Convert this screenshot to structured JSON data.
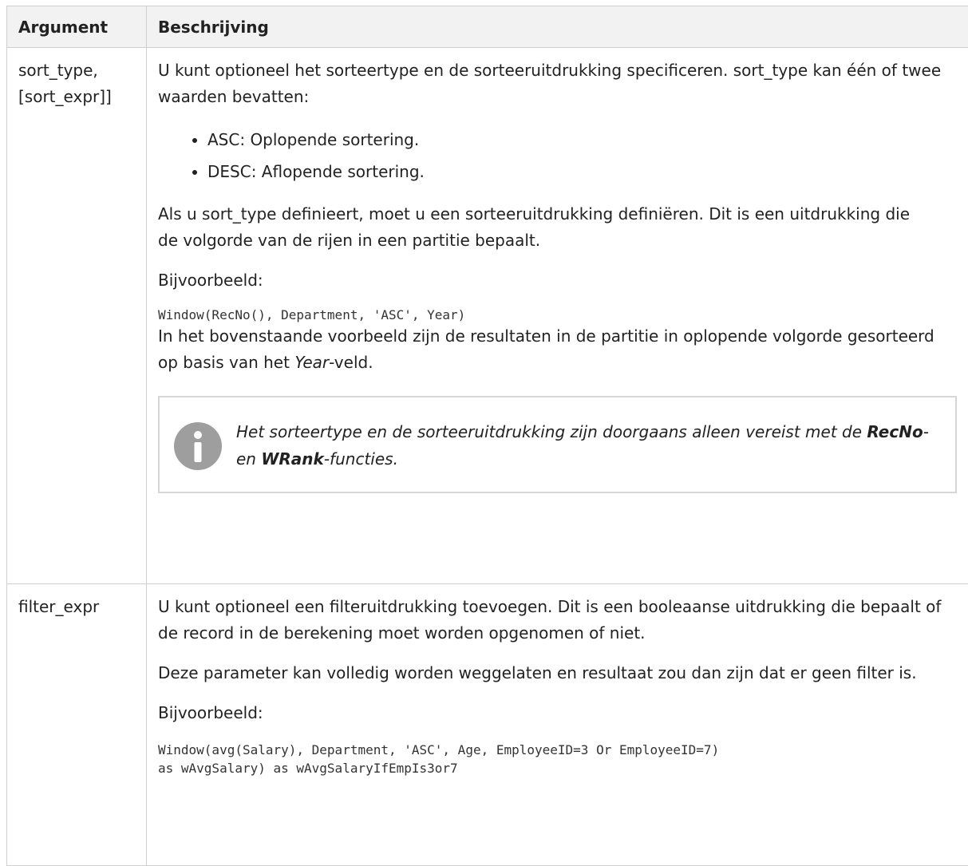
{
  "header": {
    "col1": "Argument",
    "col2": "Beschrijving"
  },
  "rows": [
    {
      "arg_line1": "sort_type,",
      "arg_line2": "[sort_expr]]",
      "p1": "U kunt optioneel het sorteertype en de sorteeruitdrukking specificeren. sort_type kan één of twee waarden bevatten:",
      "items": [
        "ASC: Oplopende sortering.",
        "DESC: Aflopende sortering."
      ],
      "p2": "Als u sort_type definieert, moet u een sorteeruitdrukking definiëren. Dit is een uitdrukking die de volgorde van de rijen in een partitie bepaalt.",
      "example_label": "Bijvoorbeeld:",
      "code": "Window(RecNo(), Department, 'ASC', Year)",
      "after_code_pre": "In het bovenstaande voorbeeld zijn de resultaten in de partitie in oplopende volgorde gesorteerd op basis van het ",
      "after_code_em": "Year",
      "after_code_post": "-veld.",
      "note": {
        "icon": "info-icon",
        "pre": "Het sorteertype en de sorteeruitdrukking zijn doorgaans alleen vereist met de ",
        "b1": "RecNo",
        "mid": "- en ",
        "b2": "WRank",
        "post": "-functies."
      }
    },
    {
      "arg": "filter_expr",
      "p1": "U kunt optioneel een filteruitdrukking toevoegen. Dit is een booleaanse uitdrukking die bepaalt of de record in de berekening moet worden opgenomen of niet.",
      "p2": "Deze parameter kan volledig worden weggelaten en resultaat zou dan zijn dat er geen filter is.",
      "example_label": "Bijvoorbeeld:",
      "code_line1": "Window(avg(Salary), Department, 'ASC', Age, EmployeeID=3 Or EmployeeID=7)",
      "code_line2": "as wAvgSalary) as wAvgSalaryIfEmpIs3or7"
    }
  ],
  "colors": {
    "header_bg": "#f2f2f2",
    "border": "#cfcfcf",
    "icon": "#9e9e9e"
  }
}
